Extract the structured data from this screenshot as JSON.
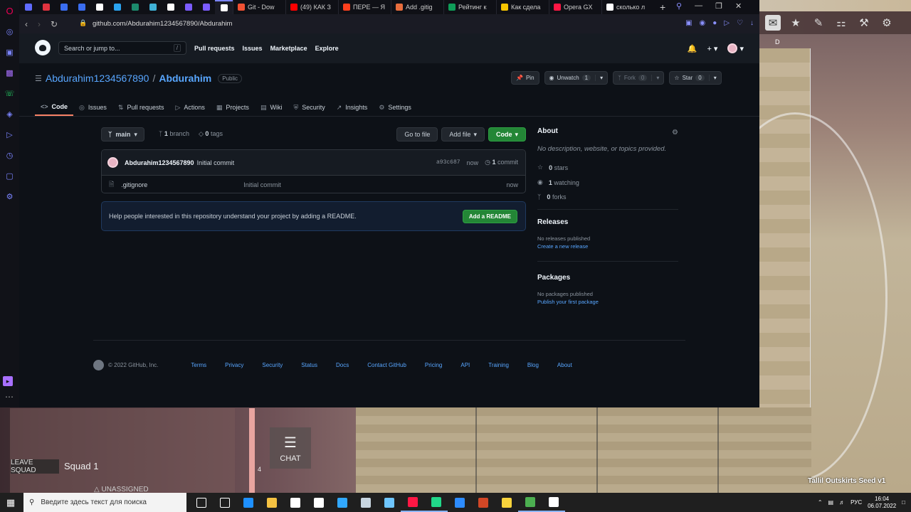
{
  "browser": {
    "tabs": [
      {
        "label": "",
        "icon": "opera-icon",
        "color": "#5f6bff"
      },
      {
        "label": "",
        "icon": "tab-icon",
        "color": "#e0333f"
      },
      {
        "label": "",
        "icon": "tab-icon",
        "color": "#3a6df0"
      },
      {
        "label": "",
        "icon": "tab-icon",
        "color": "#3a6df0"
      },
      {
        "label": "",
        "icon": "tab-icon",
        "color": "#ffffff"
      },
      {
        "label": "",
        "icon": "telegram-icon",
        "color": "#2aa3ef"
      },
      {
        "label": "",
        "icon": "tab-icon",
        "color": "#1c8a6c"
      },
      {
        "label": "",
        "icon": "edge-icon",
        "color": "#3fb1d6"
      },
      {
        "label": "",
        "icon": "tab-icon",
        "color": "#ffffff"
      },
      {
        "label": "",
        "icon": "tab-icon",
        "color": "#7b5cff"
      },
      {
        "label": "",
        "icon": "tab-icon",
        "color": "#7b5cff"
      },
      {
        "label": "",
        "icon": "github-icon",
        "color": "#ffffff",
        "active": true
      },
      {
        "label": "Git - Dow",
        "icon": "git-icon",
        "color": "#f05133"
      },
      {
        "label": "(49) КАК З",
        "icon": "youtube-icon",
        "color": "#ff0000"
      },
      {
        "label": "ПЕРЕ — Я",
        "icon": "yandex-icon",
        "color": "#fc3f1d"
      },
      {
        "label": "Add .gitig",
        "icon": "tab-icon",
        "color": "#e86d3d"
      },
      {
        "label": "Рейтинг к",
        "icon": "sheets-icon",
        "color": "#0f9d58"
      },
      {
        "label": "Как сдела",
        "icon": "tab-icon",
        "color": "#f6c400"
      },
      {
        "label": "Opera GX",
        "icon": "opera-gx-icon",
        "color": "#ff1744"
      },
      {
        "label": "сколько л",
        "icon": "google-icon",
        "color": "#ffffff"
      }
    ],
    "url": "github.com/Abdurahim1234567890/Abdurahim"
  },
  "github": {
    "search_placeholder": "Search or jump to...",
    "search_key": "/",
    "nav": [
      "Pull requests",
      "Issues",
      "Marketplace",
      "Explore"
    ],
    "owner": "Abdurahim1234567890",
    "separator": "/",
    "repo": "Abdurahim",
    "visibility": "Public",
    "actions": {
      "pin": "Pin",
      "unwatch": "Unwatch",
      "unwatch_count": "1",
      "fork": "Fork",
      "fork_count": "0",
      "star": "Star",
      "star_count": "0"
    },
    "tabs": [
      {
        "label": "Code",
        "icon": "code-icon",
        "active": true
      },
      {
        "label": "Issues",
        "icon": "issue-icon"
      },
      {
        "label": "Pull requests",
        "icon": "pull-request-icon"
      },
      {
        "label": "Actions",
        "icon": "play-icon"
      },
      {
        "label": "Projects",
        "icon": "table-icon"
      },
      {
        "label": "Wiki",
        "icon": "book-icon"
      },
      {
        "label": "Security",
        "icon": "shield-icon"
      },
      {
        "label": "Insights",
        "icon": "graph-icon"
      },
      {
        "label": "Settings",
        "icon": "gear-icon"
      }
    ],
    "branch": "main",
    "branch_count": "1",
    "branch_word": "branch",
    "tag_count": "0",
    "tag_word": "tags",
    "go_to_file": "Go to file",
    "add_file": "Add file",
    "code_button": "Code",
    "commit": {
      "author": "Abdurahim1234567890",
      "message": "Initial commit",
      "sha": "a93c687",
      "age": "now",
      "count": "1",
      "count_word": "commit"
    },
    "files": [
      {
        "name": ".gitignore",
        "message": "Initial commit",
        "age": "now"
      }
    ],
    "readme_prompt": "Help people interested in this repository understand your project by adding a README.",
    "add_readme": "Add a README",
    "about": {
      "title": "About",
      "description": "No description, website, or topics provided.",
      "stars": "0",
      "stars_word": "stars",
      "watching": "1",
      "watching_word": "watching",
      "forks": "0",
      "forks_word": "forks"
    },
    "releases": {
      "title": "Releases",
      "empty": "No releases published",
      "link": "Create a new release"
    },
    "packages": {
      "title": "Packages",
      "empty": "No packages published",
      "link": "Publish your first package"
    },
    "footer": {
      "copyright": "© 2022 GitHub, Inc.",
      "links": [
        "Terms",
        "Privacy",
        "Security",
        "Status",
        "Docs",
        "Contact GitHub",
        "Pricing",
        "API",
        "Training",
        "Blog",
        "About"
      ]
    }
  },
  "game": {
    "leave_squad": "LEAVE SQUAD",
    "squad_name": "Squad 1",
    "unassigned": "UNASSIGNED",
    "chat": "CHAT",
    "number": "4",
    "map_name": "Tallil Outskirts Seed v1",
    "top_label": "D"
  },
  "taskbar": {
    "search_placeholder": "Введите здесь текст для поиска",
    "language": "РУС",
    "time": "16:04",
    "date": "06.07.2022",
    "apps": [
      {
        "icon": "task-view-icon",
        "color": "#ffffff"
      },
      {
        "icon": "widgets-icon",
        "color": "#ffffff"
      },
      {
        "icon": "edge-icon",
        "color": "#1e90ff"
      },
      {
        "icon": "folder-icon",
        "color": "#f5c242"
      },
      {
        "icon": "store-icon",
        "color": "#ffffff"
      },
      {
        "icon": "mail-icon",
        "color": "#ffffff"
      },
      {
        "icon": "photoshop-icon",
        "color": "#31a8ff"
      },
      {
        "icon": "steam-icon",
        "color": "#c7d5e0"
      },
      {
        "icon": "app-icon",
        "color": "#6ec6ff"
      },
      {
        "icon": "opera-icon",
        "color": "#ff1744"
      },
      {
        "icon": "pycharm-icon",
        "color": "#21d789"
      },
      {
        "icon": "zoom-icon",
        "color": "#2d8cff"
      },
      {
        "icon": "powerpoint-icon",
        "color": "#d24726"
      },
      {
        "icon": "sticky-notes-icon",
        "color": "#f7d33c"
      },
      {
        "icon": "app-icon",
        "color": "#4caf50"
      },
      {
        "icon": "squad-icon",
        "color": "#ffffff"
      }
    ]
  }
}
